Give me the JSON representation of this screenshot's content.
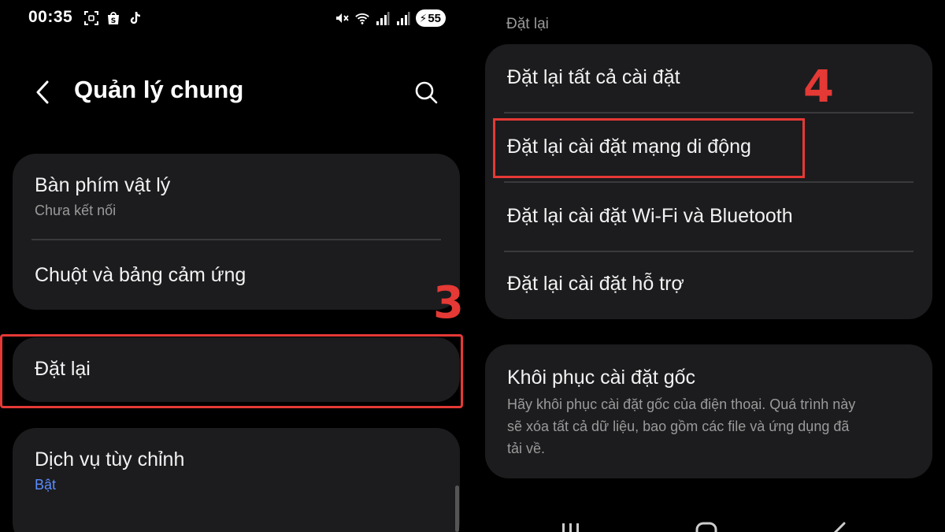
{
  "status_bar": {
    "time": "00:35",
    "battery": "55",
    "icons": [
      "screenshot-icon",
      "shopee-icon",
      "tiktok-icon",
      "mute-icon",
      "wifi-icon",
      "signal-icon",
      "signal-icon",
      "battery-icon"
    ]
  },
  "left_screen": {
    "header": {
      "title": "Quản lý chung"
    },
    "items": [
      {
        "title": "Bàn phím vật lý",
        "subtitle": "Chưa kết nối"
      },
      {
        "title": "Chuột và bảng cảm ứng"
      },
      {
        "title": "Đặt lại"
      },
      {
        "title": "Dịch vụ tùy chỉnh",
        "subtitle": "Bật"
      }
    ],
    "step_label": "3"
  },
  "right_screen": {
    "section_label": "Đặt lại",
    "reset_items": [
      {
        "title": "Đặt lại tất cả cài đặt"
      },
      {
        "title": "Đặt lại cài đặt mạng di động"
      },
      {
        "title": "Đặt lại cài đặt Wi-Fi và Bluetooth"
      },
      {
        "title": "Đặt lại cài đặt hỗ trợ"
      }
    ],
    "factory_reset": {
      "title": "Khôi phục cài đặt gốc",
      "description_lines": [
        "Hãy khôi phục cài đặt gốc của điện thoại. Quá trình này",
        "sẽ xóa tất cả dữ liệu, bao gồm các file và ứng dụng đã",
        "tải về."
      ]
    },
    "step_label": "4"
  },
  "colors": {
    "background": "#000000",
    "card": "#1c1c1e",
    "highlight": "#e53935",
    "accent_blue": "#5b8cff"
  }
}
